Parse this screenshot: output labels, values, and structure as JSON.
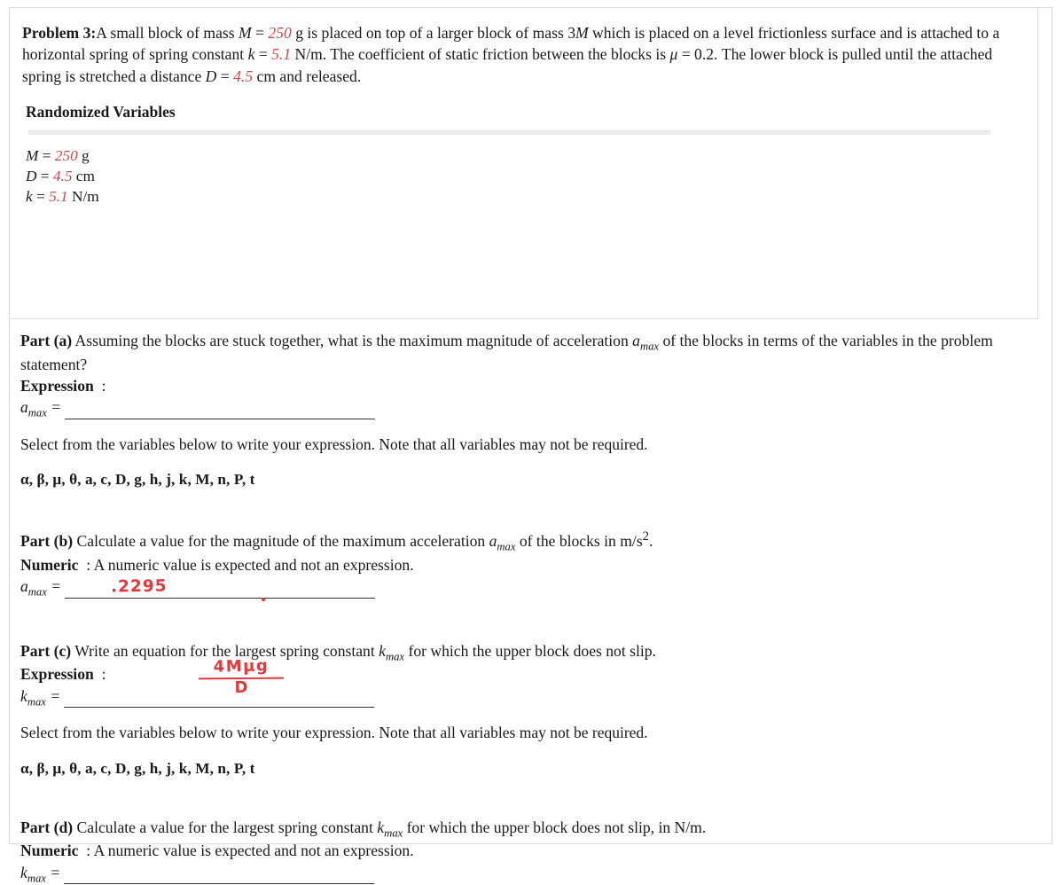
{
  "problem": {
    "label": "Problem 3:",
    "text_1": "A small block of mass ",
    "m_sym": "M",
    "eq1": " = ",
    "m_val": "250",
    "text_2": " g is placed on top of a larger block of mass 3",
    "m_sym2": "M",
    "text_3": " which is placed on a level frictionless surface and is attached to a horizontal spring of spring constant ",
    "k_sym": "k",
    "eq2": " = ",
    "k_val": "5.1",
    "text_4": " N/m. The coefficient of static friction between the blocks is ",
    "mu_sym": "μ",
    "eq3": " = ",
    "mu_val": "0.2",
    "text_5": ". The lower block is pulled until the attached spring is stretched a distance ",
    "d_sym": "D",
    "eq4": " = ",
    "d_val": "4.5",
    "text_6": " cm and released."
  },
  "randomized": {
    "heading": "Randomized Variables",
    "rows": [
      {
        "name": "M",
        "eq": " = ",
        "value": "250",
        "unit": " g"
      },
      {
        "name": "D",
        "eq": " = ",
        "value": "4.5",
        "unit": " cm"
      },
      {
        "name": "k",
        "eq": " = ",
        "value": "5.1",
        "unit": " N/m"
      }
    ]
  },
  "parts": {
    "a": {
      "label": "Part (a)",
      "question_1": " Assuming the blocks are stuck together, what is the maximum magnitude of acceleration ",
      "q_var": "a",
      "q_var_sub": "max",
      "question_2": " of the blocks in terms of the variables in the problem statement?",
      "answer_type": "Expression",
      "colon": ":",
      "answer_var": "a",
      "answer_var_sub": "max",
      "equals": "=",
      "answer_value": ""
    },
    "b": {
      "label": "Part (b)",
      "question_1": " Calculate a value for the magnitude of the maximum acceleration ",
      "q_var": "a",
      "q_var_sub": "max",
      "question_2": " of the blocks in m/s",
      "question_exp": "2",
      "question_3": ".",
      "answer_type": "Numeric",
      "colon": ": A numeric value is expected and not an expression.",
      "answer_var": "a",
      "answer_var_sub": "max",
      "equals": "=",
      "handwritten_answer": ".2295"
    },
    "c": {
      "label": "Part (c)",
      "question_1": " Write an equation for the largest spring constant ",
      "q_var": "k",
      "q_var_sub": "max",
      "question_2": " for which the upper block does not slip.",
      "answer_type": "Expression",
      "colon": ":",
      "answer_var": "k",
      "answer_var_sub": "max",
      "equals": "=",
      "handwritten_numerator": "4Mμg",
      "handwritten_denominator": "D"
    },
    "d": {
      "label": "Part (d)",
      "question_1": " Calculate a value for the largest spring constant ",
      "q_var": "k",
      "q_var_sub": "max",
      "question_2": " for which the upper block does not slip, in N/m.",
      "answer_type": "Numeric",
      "colon": ": A numeric value is expected and not an expression.",
      "answer_var": "k",
      "answer_var_sub": "max",
      "equals": "=",
      "answer_value": ""
    }
  },
  "select_note": {
    "text": "Select from the variables below to write your expression. Note that all variables may not be required.",
    "variables": "α, β, μ, θ, a, c, D, g, h, j, k, M, n, P, t"
  },
  "colors": {
    "randomized_value": "#c0504d",
    "handwriting": "#e0393e",
    "text": "#1a1a1a",
    "border": "#d9d9d9"
  }
}
